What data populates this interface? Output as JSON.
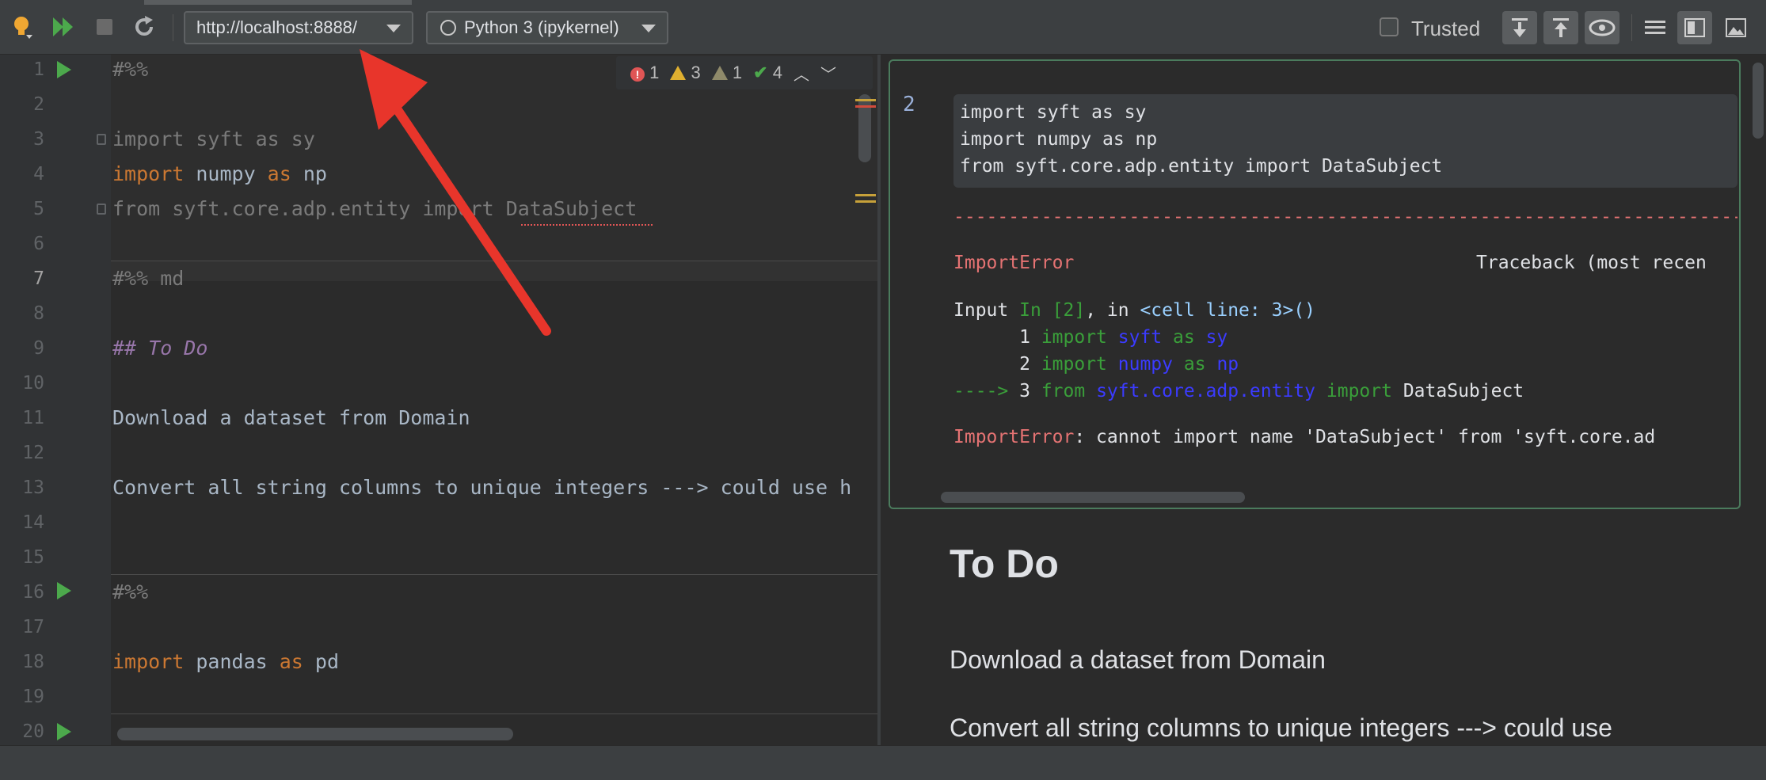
{
  "toolbar": {
    "url": "http://localhost:8888/",
    "kernel": "Python 3 (ipykernel)",
    "trusted_label": "Trusted",
    "icons": [
      "lightbulb-icon",
      "run-all-icon",
      "stop-icon",
      "restart-icon",
      "download-icon",
      "upload-icon",
      "eye-icon",
      "list-icon",
      "split-view-icon",
      "image-icon"
    ]
  },
  "inspection": {
    "errors": "1",
    "warnings": "3",
    "weak_warnings": "1",
    "ok": "4"
  },
  "editor": {
    "line_numbers": [
      "1",
      "2",
      "3",
      "4",
      "5",
      "6",
      "7",
      "8",
      "9",
      "10",
      "11",
      "12",
      "13",
      "14",
      "15",
      "16",
      "17",
      "18",
      "19",
      "20"
    ],
    "lines": {
      "l1": "#%%",
      "l3": "import syft as sy",
      "l4_kw1": "import",
      "l4_mid": " numpy ",
      "l4_kw2": "as",
      "l4_end": " np",
      "l5": "from syft.core.adp.entity import DataSubject",
      "l7": "#%% md",
      "l9": "## To Do",
      "l11": "Download a dataset from Domain",
      "l13": "Convert all string columns to unique integers ---> could use h",
      "l16": "#%%",
      "l18_kw1": "import",
      "l18_mid": " pandas ",
      "l18_kw2": "as",
      "l18_end": " pd"
    }
  },
  "preview": {
    "cell_number": "2",
    "input_lines": [
      "import syft as sy",
      "import numpy as np",
      "from syft.core.adp.entity import DataSubject"
    ],
    "dashes": "---------------------------------------------------------------------------",
    "error_name": "ImportError",
    "traceback_label": "Traceback (most recen",
    "input_ref": {
      "a": "Input ",
      "b": "In [2]",
      "c": ", in ",
      "d": "<cell line: 3>",
      "e": "()"
    },
    "tb1": {
      "num": "1",
      "kw": "import",
      "mod": "syft",
      "as": "as",
      "alias": "sy"
    },
    "tb2": {
      "num": "2",
      "kw": "import",
      "mod": "numpy",
      "as": "as",
      "alias": "np"
    },
    "tb3": {
      "arrow": "----> ",
      "num": "3",
      "kw": "from",
      "mod": "syft.core.adp.entity",
      "imp": "import",
      "name": "DataSubject"
    },
    "error_msg": ": cannot import name 'DataSubject' from 'syft.core.ad",
    "md_heading": "To Do",
    "md_p1": "Download a dataset from Domain",
    "md_p2": "Convert all string columns to unique integers ---> could use"
  }
}
